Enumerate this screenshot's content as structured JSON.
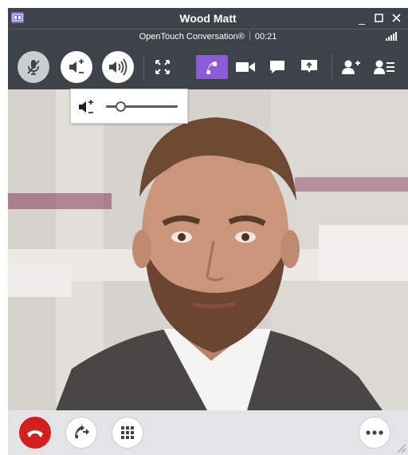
{
  "window": {
    "title": "Wood Matt",
    "minimize_glyph": "_",
    "maximize_glyph": "☐",
    "close_glyph": "✕"
  },
  "status": {
    "app_name": "OpenTouch Conversation®",
    "call_duration": "00:21",
    "signal_icon": "signal-bars-icon"
  },
  "toolbar": {
    "buttons": [
      {
        "name": "mute-microphone",
        "icon": "microphone-off-icon"
      },
      {
        "name": "volume-adjust",
        "icon": "volume-plus-minus-icon"
      },
      {
        "name": "speaker",
        "icon": "speaker-loud-icon"
      },
      {
        "name": "fullscreen",
        "icon": "expand-icon"
      },
      {
        "name": "audio-call",
        "icon": "phone-icon",
        "active": true
      },
      {
        "name": "video",
        "icon": "video-camera-icon"
      },
      {
        "name": "chat",
        "icon": "chat-bubble-icon"
      },
      {
        "name": "screen-share",
        "icon": "screen-share-icon"
      },
      {
        "name": "add-participant",
        "icon": "add-user-icon"
      },
      {
        "name": "participants-list",
        "icon": "user-list-icon"
      }
    ],
    "active_color": "#8a5cd6"
  },
  "volume_popup": {
    "icon": "volume-plus-minus-icon",
    "level": 0.2
  },
  "video": {
    "content": "remote participant video"
  },
  "bottom_bar": {
    "buttons": [
      {
        "name": "hang-up",
        "icon": "phone-hangup-icon",
        "color": "#d21f1f"
      },
      {
        "name": "transfer",
        "icon": "call-forward-icon"
      },
      {
        "name": "dialpad",
        "icon": "keypad-icon"
      },
      {
        "name": "more",
        "icon": "more-dots-icon"
      }
    ]
  }
}
